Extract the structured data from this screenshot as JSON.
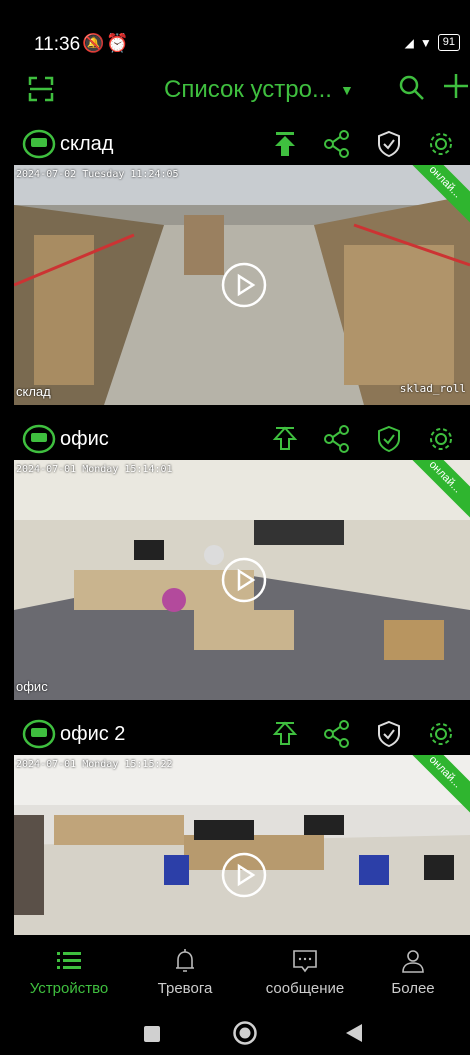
{
  "status_bar": {
    "time": "11:36",
    "battery": "91"
  },
  "header": {
    "title": "Список устро...",
    "icons": [
      "scan-icon",
      "search-icon",
      "plus-icon"
    ]
  },
  "cameras": [
    {
      "name": "склад",
      "timestamp": "2024-07-02 Tuesday 11:24:05",
      "overlay_label": "склад",
      "corner_label": "sklad_roll",
      "badge": "онлай..."
    },
    {
      "name": "офис",
      "timestamp": "2024-07-01 Monday 15:14:01",
      "overlay_label": "офис",
      "badge": "онлай..."
    },
    {
      "name": "офис 2",
      "timestamp": "2024-07-01 Monday 15:15:22",
      "badge": "онлай..."
    }
  ],
  "bottom_nav": [
    {
      "label": "Устройство",
      "icon": "list-icon",
      "active": true
    },
    {
      "label": "Тревога",
      "icon": "bell-icon",
      "active": false
    },
    {
      "label": "сообщение",
      "icon": "message-icon",
      "active": false
    },
    {
      "label": "Более",
      "icon": "person-icon",
      "active": false
    }
  ],
  "colors": {
    "accent": "#3fbf3f",
    "online_badge": "#2fb52f",
    "background": "#000000"
  }
}
